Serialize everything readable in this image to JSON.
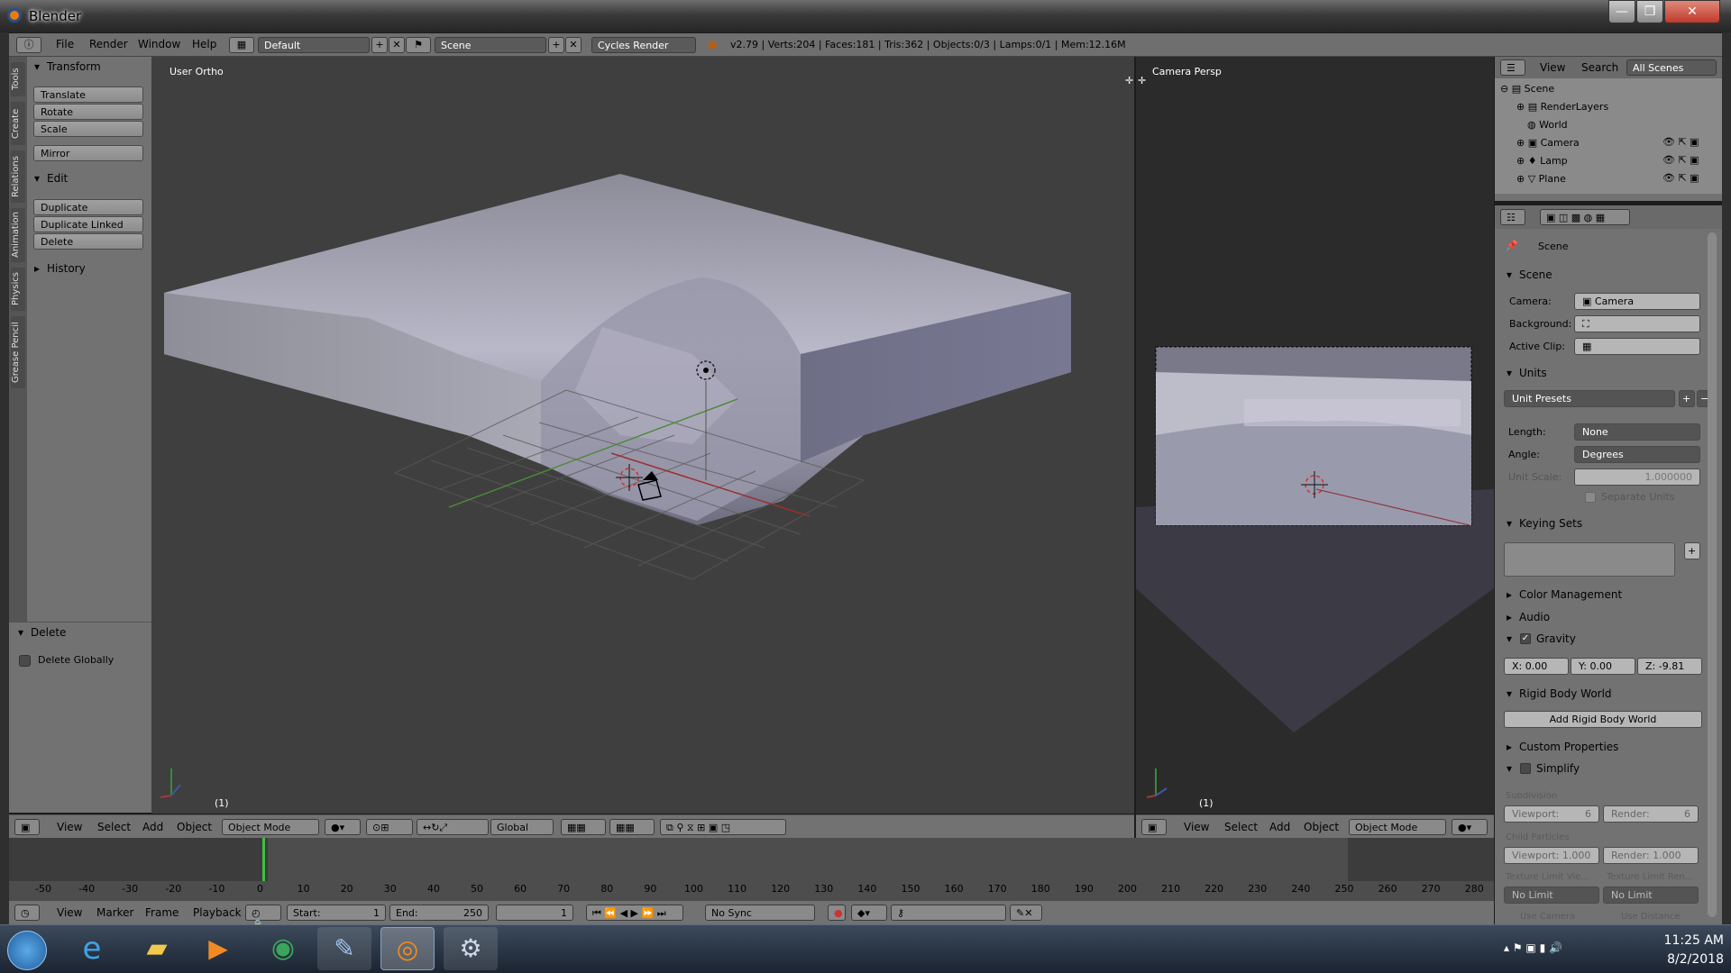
{
  "window": {
    "title": "Blender",
    "minimize": "—",
    "maximize": "❐",
    "close": "✕"
  },
  "info_header": {
    "menus": [
      "File",
      "Render",
      "Window",
      "Help"
    ],
    "layout": "Default",
    "scene": "Scene",
    "engine": "Cycles Render",
    "stats": "v2.79 | Verts:204 | Faces:181 | Tris:362 | Objects:0/3 | Lamps:0/1 | Mem:12.16M"
  },
  "tool_tabs": [
    "Tools",
    "Create",
    "Relations",
    "Animation",
    "Physics",
    "Grease Pencil"
  ],
  "tool_shelf": {
    "transform_title": "Transform",
    "transform_buttons": [
      "Translate",
      "Rotate",
      "Scale"
    ],
    "mirror": "Mirror",
    "edit_title": "Edit",
    "edit_buttons": [
      "Duplicate",
      "Duplicate Linked",
      "Delete"
    ],
    "history_title": "History"
  },
  "redo_panel": {
    "title": "Delete",
    "checkbox_label": "Delete Globally"
  },
  "viewport_left": {
    "label": "User Ortho",
    "frame": "(1)",
    "menus": [
      "View",
      "Select",
      "Add",
      "Object"
    ],
    "mode": "Object Mode",
    "orientation": "Global"
  },
  "viewport_right": {
    "label": "Camera Persp",
    "frame": "(1)",
    "menus": [
      "View",
      "Select",
      "Add",
      "Object"
    ],
    "mode": "Object Mode"
  },
  "timeline": {
    "ticks": [
      "-50",
      "-40",
      "-30",
      "-20",
      "-10",
      "0",
      "10",
      "20",
      "30",
      "40",
      "50",
      "60",
      "70",
      "80",
      "90",
      "100",
      "110",
      "120",
      "130",
      "140",
      "150",
      "160",
      "170",
      "180",
      "190",
      "200",
      "210",
      "220",
      "230",
      "240",
      "250",
      "260",
      "270",
      "280"
    ],
    "menus": [
      "View",
      "Marker",
      "Frame",
      "Playback"
    ],
    "start_label": "Start:",
    "start": "1",
    "end_label": "End:",
    "end": "250",
    "current": "1",
    "sync": "No Sync"
  },
  "outliner": {
    "view": "View",
    "search": "Search",
    "filter": "All Scenes",
    "items": [
      "Scene",
      "RenderLayers",
      "World",
      "Camera",
      "Lamp",
      "Plane"
    ]
  },
  "properties": {
    "context": "Scene",
    "scene_section": "Scene",
    "camera_label": "Camera:",
    "camera_value": "Camera",
    "background_label": "Background:",
    "active_clip_label": "Active Clip:",
    "units_section": "Units",
    "unit_presets": "Unit Presets",
    "length_label": "Length:",
    "length_value": "None",
    "angle_label": "Angle:",
    "angle_value": "Degrees",
    "unit_scale_label": "Unit Scale:",
    "unit_scale_value": "1.000000",
    "separate_units": "Separate Units",
    "keying_sets": "Keying Sets",
    "color_management": "Color Management",
    "audio": "Audio",
    "gravity": "Gravity",
    "gravity_x": "X:  0.00",
    "gravity_y": "Y:  0.00",
    "gravity_z": "Z: -9.81",
    "rigid_body_world": "Rigid Body World",
    "add_rigid_body_world": "Add Rigid Body World",
    "custom_properties": "Custom Properties",
    "simplify": "Simplify",
    "subdivision": "Subdivision",
    "viewport_sub": "Viewport:",
    "viewport_sub_val": "6",
    "render_sub": "Render:",
    "render_sub_val": "6",
    "child_particles": "Child Particles",
    "viewport_cp": "Viewport: 1.000",
    "render_cp": "Render: 1.000",
    "texture_limit_viewport": "Texture Limit Vie...",
    "texture_limit_render": "Texture Limit Ren...",
    "no_limit_a": "No Limit",
    "no_limit_b": "No Limit",
    "use_camera": "Use Camera",
    "use_distance": "Use Distance"
  },
  "taskbar": {
    "time": "11:25 AM",
    "date": "8/2/2018"
  }
}
